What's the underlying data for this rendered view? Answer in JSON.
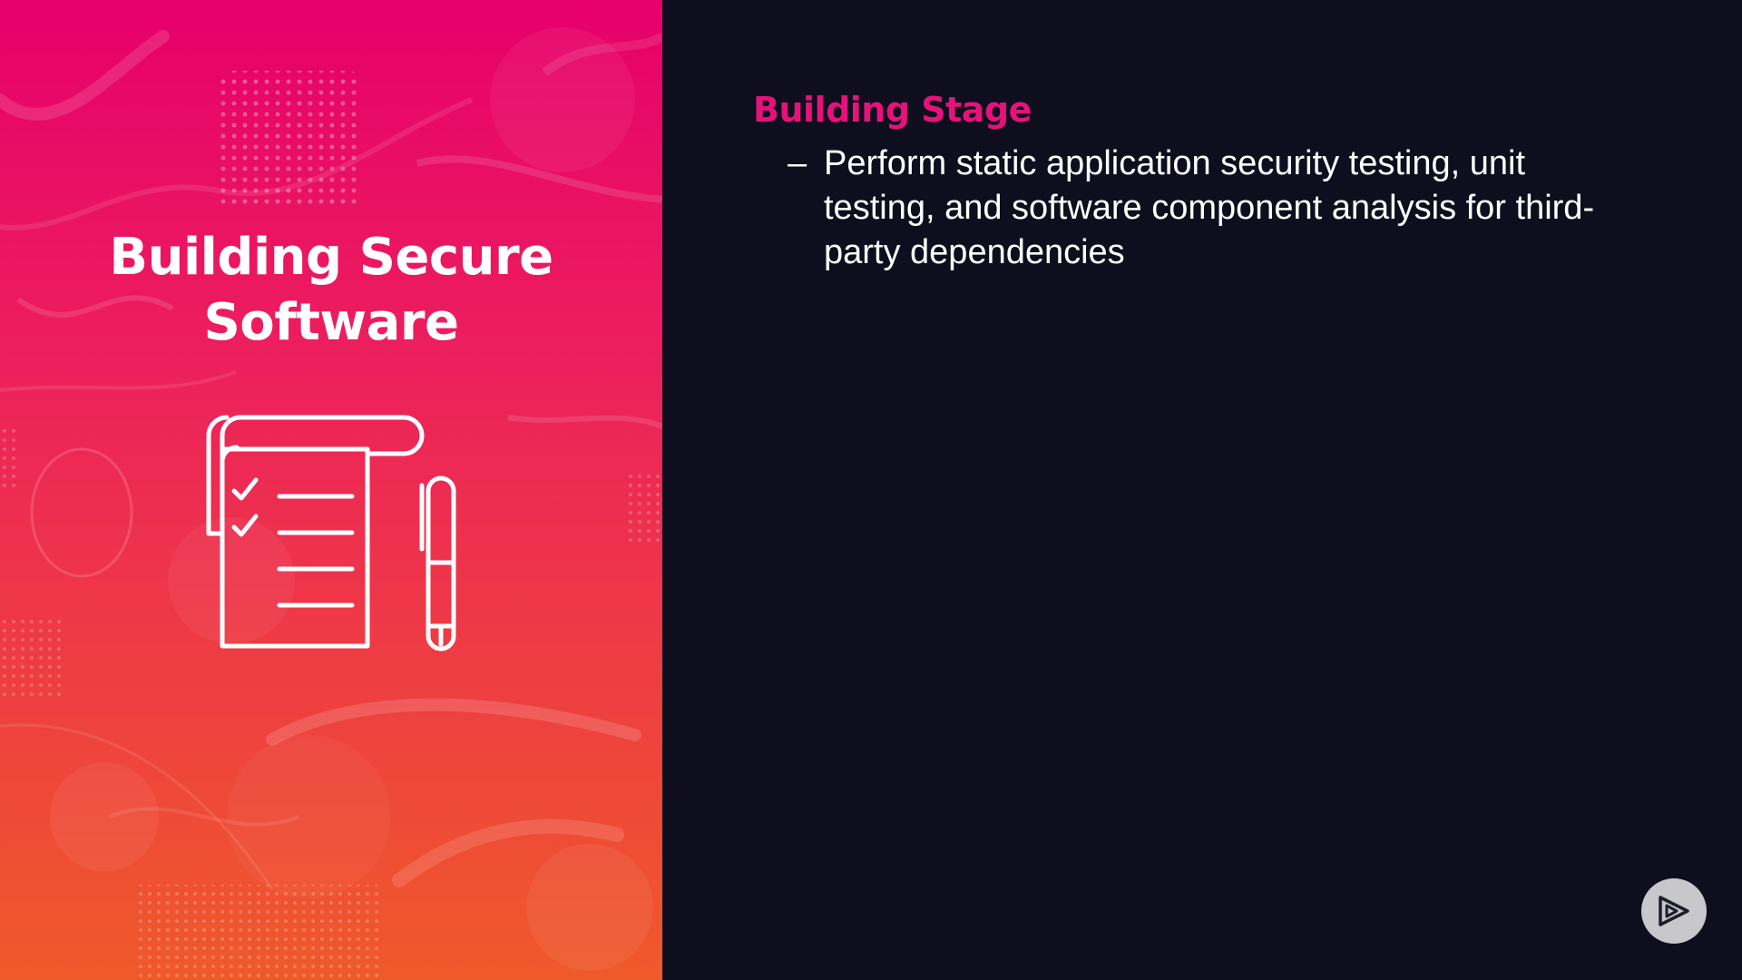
{
  "slide": {
    "left": {
      "title_line1": "Building Secure",
      "title_line2": "Software",
      "icon": "checklist-with-pen-icon",
      "gradient_colors": [
        "#e6006b",
        "#ec1e5e",
        "#ee3a45",
        "#ef5a2a"
      ]
    },
    "right": {
      "heading": "Building Stage",
      "heading_color": "#e6127a",
      "background_color": "#0f0e1e",
      "bullets": [
        {
          "marker": "–",
          "text": "Perform static application security testing, unit testing, and software component analysis for third-party dependencies"
        }
      ]
    },
    "player": {
      "icon": "play-icon"
    }
  }
}
